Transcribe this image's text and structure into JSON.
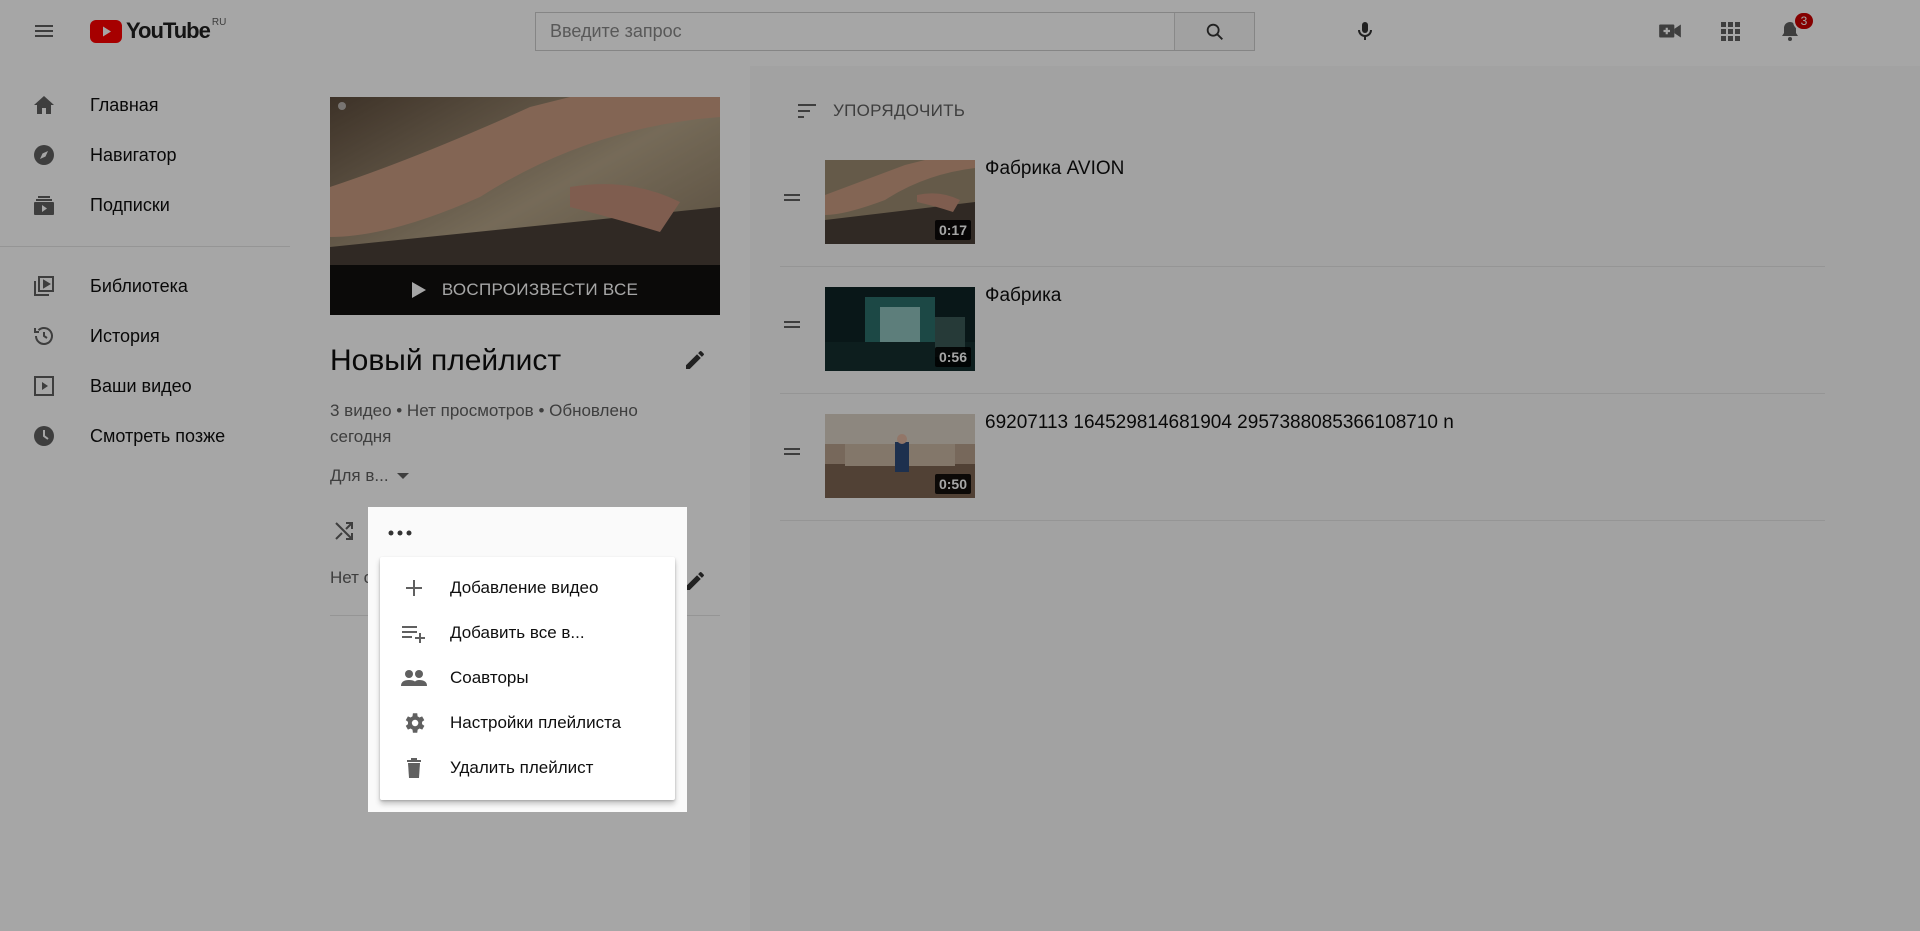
{
  "masthead": {
    "logo_text": "YouTube",
    "logo_region": "RU",
    "search_placeholder": "Введите запрос",
    "notification_count": "3"
  },
  "sidebar": {
    "items": [
      {
        "label": "Главная",
        "icon": "home-icon"
      },
      {
        "label": "Навигатор",
        "icon": "compass-icon"
      },
      {
        "label": "Подписки",
        "icon": "subscriptions-icon"
      },
      {
        "label": "Библиотека",
        "icon": "library-icon"
      },
      {
        "label": "История",
        "icon": "history-icon"
      },
      {
        "label": "Ваши видео",
        "icon": "your-videos-icon"
      },
      {
        "label": "Смотреть позже",
        "icon": "watch-later-icon"
      }
    ]
  },
  "playlist": {
    "play_all": "ВОСПРОИЗВЕСТИ ВСЕ",
    "title": "Новый плейлист",
    "stats": "3 видео • Нет просмотров • Обновлено сегодня",
    "privacy": "Для в...",
    "description": "Нет описания"
  },
  "main": {
    "sort_label": "УПОРЯДОЧИТЬ",
    "videos": [
      {
        "title": "Фабрика AVION",
        "duration": "0:17"
      },
      {
        "title": "Фабрика",
        "duration": "0:56"
      },
      {
        "title": "69207113 164529814681904 2957388085366108710 n",
        "duration": "0:50"
      }
    ]
  },
  "menu": {
    "items": [
      {
        "label": "Добавление видео",
        "icon": "plus-icon"
      },
      {
        "label": "Добавить все в...",
        "icon": "playlist-add-icon"
      },
      {
        "label": "Соавторы",
        "icon": "people-icon"
      },
      {
        "label": "Настройки плейлиста",
        "icon": "gear-icon"
      },
      {
        "label": "Удалить плейлист",
        "icon": "trash-icon"
      }
    ]
  },
  "colors": {
    "brand_red": "#ff0000",
    "badge_red": "#cc0000",
    "text_primary": "#0f0f0f",
    "text_secondary": "#606060"
  }
}
